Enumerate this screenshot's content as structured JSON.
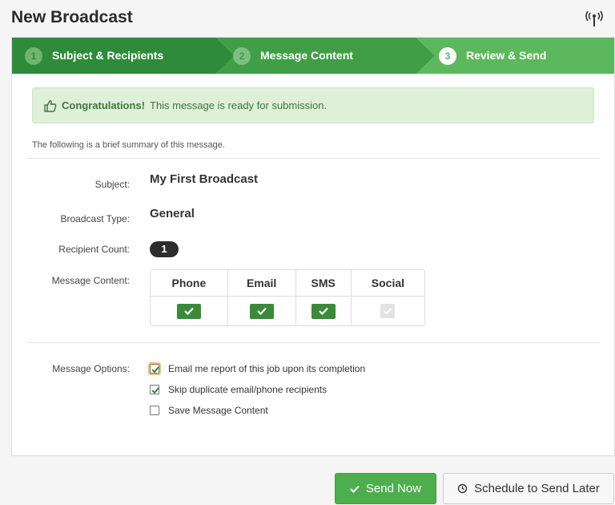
{
  "page": {
    "title": "New Broadcast"
  },
  "steps": [
    {
      "number": "1",
      "label": "Subject & Recipients"
    },
    {
      "number": "2",
      "label": "Message Content"
    },
    {
      "number": "3",
      "label": "Review & Send"
    }
  ],
  "alert": {
    "strong": "Congratulations!",
    "text": "This message is ready for submission."
  },
  "summary_text": "The following is a brief summary of this message.",
  "fields": {
    "subject": {
      "label": "Subject:",
      "value": "My First Broadcast"
    },
    "type": {
      "label": "Broadcast Type:",
      "value": "General"
    },
    "count": {
      "label": "Recipient Count:",
      "value": "1"
    },
    "content": {
      "label": "Message Content:"
    }
  },
  "content_table": {
    "headers": [
      "Phone",
      "Email",
      "SMS",
      "Social"
    ],
    "enabled": [
      true,
      true,
      true,
      false
    ]
  },
  "options": {
    "label": "Message Options:",
    "items": [
      {
        "label": "Email me report of this job upon its completion",
        "checked": true
      },
      {
        "label": "Skip duplicate email/phone recipients",
        "checked": true
      },
      {
        "label": "Save Message Content",
        "checked": false
      }
    ]
  },
  "buttons": {
    "send": "Send Now",
    "schedule": "Schedule to Send Later"
  },
  "colors": {
    "step_dark": "#2e8b3a",
    "step_mid": "#3f9e46",
    "step_active": "#5cb85c",
    "check_green": "#3a8a3a"
  }
}
